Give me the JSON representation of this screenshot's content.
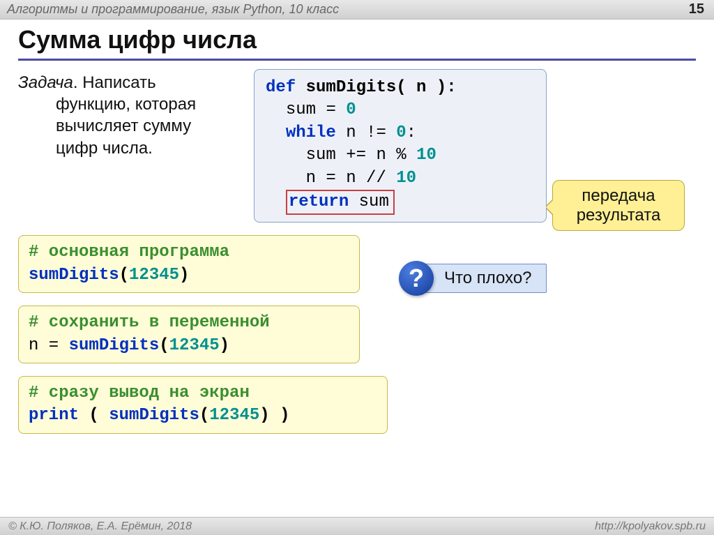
{
  "header": {
    "subject": "Алгоритмы и программирование, язык Python, 10 класс",
    "page": "15"
  },
  "title": "Сумма цифр числа",
  "task": {
    "label": "Задача",
    "textline1": ". Написать",
    "textline2": "функцию, которая",
    "textline3": "вычисляет сумму",
    "textline4": "цифр числа."
  },
  "code": {
    "l1a": "def",
    "l1b": "sumDigits",
    "l1c": "( n ):",
    "l2a": "sum",
    "l2b": "=",
    "l2c": "0",
    "l3a": "while",
    "l3b": "n",
    "l3c": "!=",
    "l3d": "0",
    "l3e": ":",
    "l4a": "sum",
    "l4b": "+=",
    "l4c": "n",
    "l4d": "%",
    "l4e": "10",
    "l5a": "n",
    "l5b": "=",
    "l5c": "n",
    "l5d": "//",
    "l5e": "10",
    "l6a": "return",
    "l6b": "sum"
  },
  "callout_pass_l1": "передача",
  "callout_pass_l2": "результата",
  "block1": {
    "comment": "# основная программа",
    "fn": "sumDigits",
    "open": "(",
    "arg": "12345",
    "close": ")"
  },
  "block2": {
    "comment": "# сохранить в переменной",
    "lhs": "n = ",
    "fn": "sumDigits",
    "open": "(",
    "arg": "12345",
    "close": ")"
  },
  "block3": {
    "comment": "# сразу вывод на экран",
    "print": "print",
    "sp": " ( ",
    "fn": "sumDigits",
    "open": "(",
    "arg": "12345",
    "close": ") )"
  },
  "question": {
    "mark": "?",
    "text": "Что плохо?"
  },
  "footer": {
    "left": "© К.Ю. Поляков, Е.А. Ерёмин, 2018",
    "right": "http://kpolyakov.spb.ru"
  }
}
